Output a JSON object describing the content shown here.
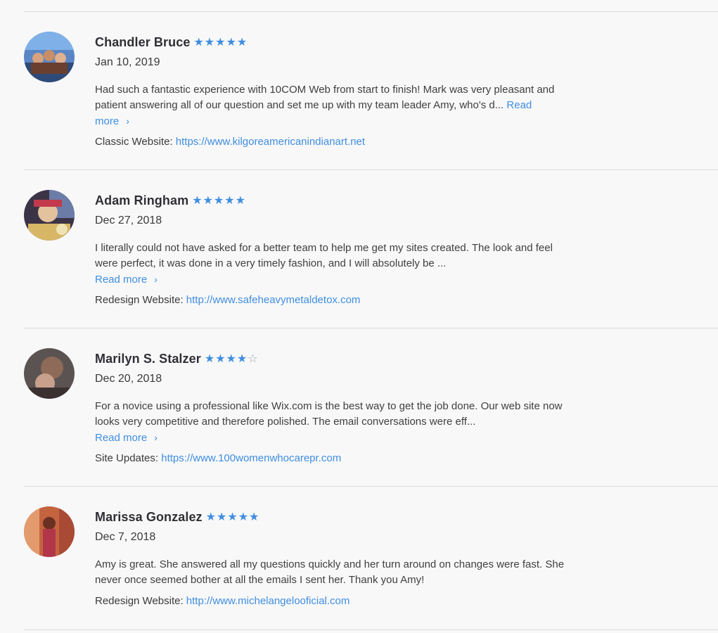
{
  "reviews": [
    {
      "name": "Chandler Bruce",
      "rating": 5,
      "date": "Jan 10, 2019",
      "text": "Had such a fantastic experience with 10COM Web from start to finish! Mark was very pleasant and patient answering all of our question and set me up with my team leader Amy, who's d... ",
      "read_more": "Read more",
      "project_label": "Classic Website:",
      "project_url": "https://www.kilgoreamericanindianart.net"
    },
    {
      "name": "Adam Ringham",
      "rating": 5,
      "date": "Dec 27, 2018",
      "text": "I literally could not have asked for a better team to help me get my sites created.  The look and feel were perfect, it was done in a very timely fashion, and I will absolutely be ...",
      "read_more": "Read more",
      "project_label": "Redesign Website:",
      "project_url": "http://www.safeheavymetaldetox.com"
    },
    {
      "name": "Marilyn S. Stalzer",
      "rating": 4,
      "date": "Dec 20, 2018",
      "text": "For a novice using a professional like Wix.com is the best way to get the job done. Our web site now looks very competitive and therefore polished. The email conversations were eff...",
      "read_more": "Read more",
      "project_label": "Site Updates:",
      "project_url": "https://www.100womenwhocarepr.com"
    },
    {
      "name": "Marissa Gonzalez",
      "rating": 5,
      "date": "Dec 7, 2018",
      "text": "Amy is great. She answered all my questions quickly and her turn around on changes were fast. She never once seemed bother at all the emails I sent her. Thank you Amy!",
      "read_more": "",
      "project_label": "Redesign Website:",
      "project_url": "http://www.michelangelooficial.com"
    }
  ],
  "colors": {
    "accent": "#3f8ee0",
    "divider": "#dcdcdc",
    "background": "#f8f8f9",
    "star_empty": "#9aa1a8"
  },
  "icons": {
    "star_filled": "star-filled-icon",
    "star_empty": "star-empty-icon",
    "read_more": "chevron-right-icon"
  }
}
